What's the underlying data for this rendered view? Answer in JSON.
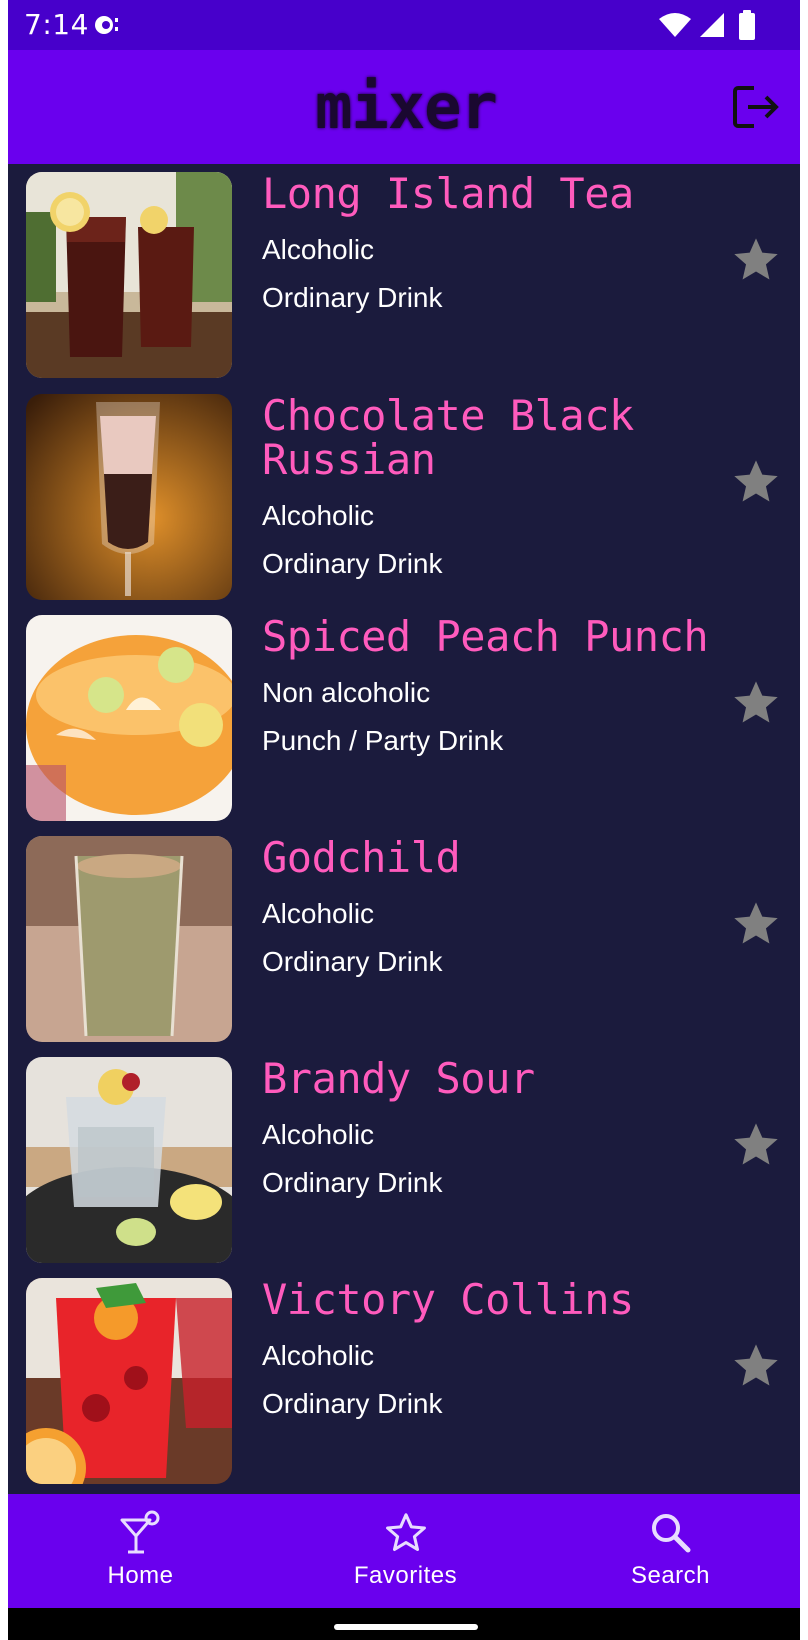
{
  "status_bar": {
    "time": "7:14",
    "icons": [
      "notification-dot-icon",
      "wifi-icon",
      "signal-icon",
      "battery-icon"
    ]
  },
  "app_bar": {
    "title": "mixer",
    "logout_icon": "logout-icon"
  },
  "colors": {
    "app_bar": "#6a00ee",
    "status_bar": "#4700cb",
    "list_background": "#1b1b3d",
    "drink_name": "#ff5bbd",
    "star_inactive": "#808080"
  },
  "drinks": [
    {
      "name": "Long Island Tea",
      "alcoholic": "Alcoholic",
      "category": "Ordinary Drink",
      "favorite": false
    },
    {
      "name": "Chocolate Black Russian",
      "alcoholic": "Alcoholic",
      "category": "Ordinary Drink",
      "favorite": false
    },
    {
      "name": "Spiced Peach Punch",
      "alcoholic": "Non alcoholic",
      "category": "Punch / Party Drink",
      "favorite": false
    },
    {
      "name": "Godchild",
      "alcoholic": "Alcoholic",
      "category": "Ordinary Drink",
      "favorite": false
    },
    {
      "name": "Brandy Sour",
      "alcoholic": "Alcoholic",
      "category": "Ordinary Drink",
      "favorite": false
    },
    {
      "name": "Victory Collins",
      "alcoholic": "Alcoholic",
      "category": "Ordinary Drink",
      "favorite": false
    }
  ],
  "bottom_nav": {
    "items": [
      {
        "label": "Home",
        "icon": "cocktail-icon"
      },
      {
        "label": "Favorites",
        "icon": "star-outline-icon"
      },
      {
        "label": "Search",
        "icon": "search-icon"
      }
    ]
  }
}
